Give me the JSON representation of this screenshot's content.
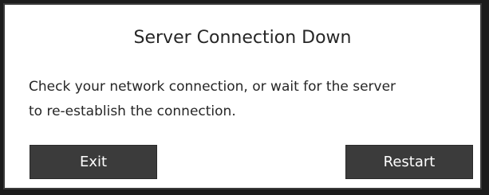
{
  "dialog": {
    "title": "Server Connection Down",
    "message_line1": "Check your network connection, or wait for the server",
    "message_line2": "to re-establish the connection.",
    "buttons": {
      "exit_label": "Exit",
      "restart_label": "Restart"
    }
  },
  "colors": {
    "dialog_background": "#ffffff",
    "button_background": "#3b3b3b",
    "button_text": "#ffffff",
    "text": "#262626",
    "backdrop": "#1c1c1c"
  }
}
